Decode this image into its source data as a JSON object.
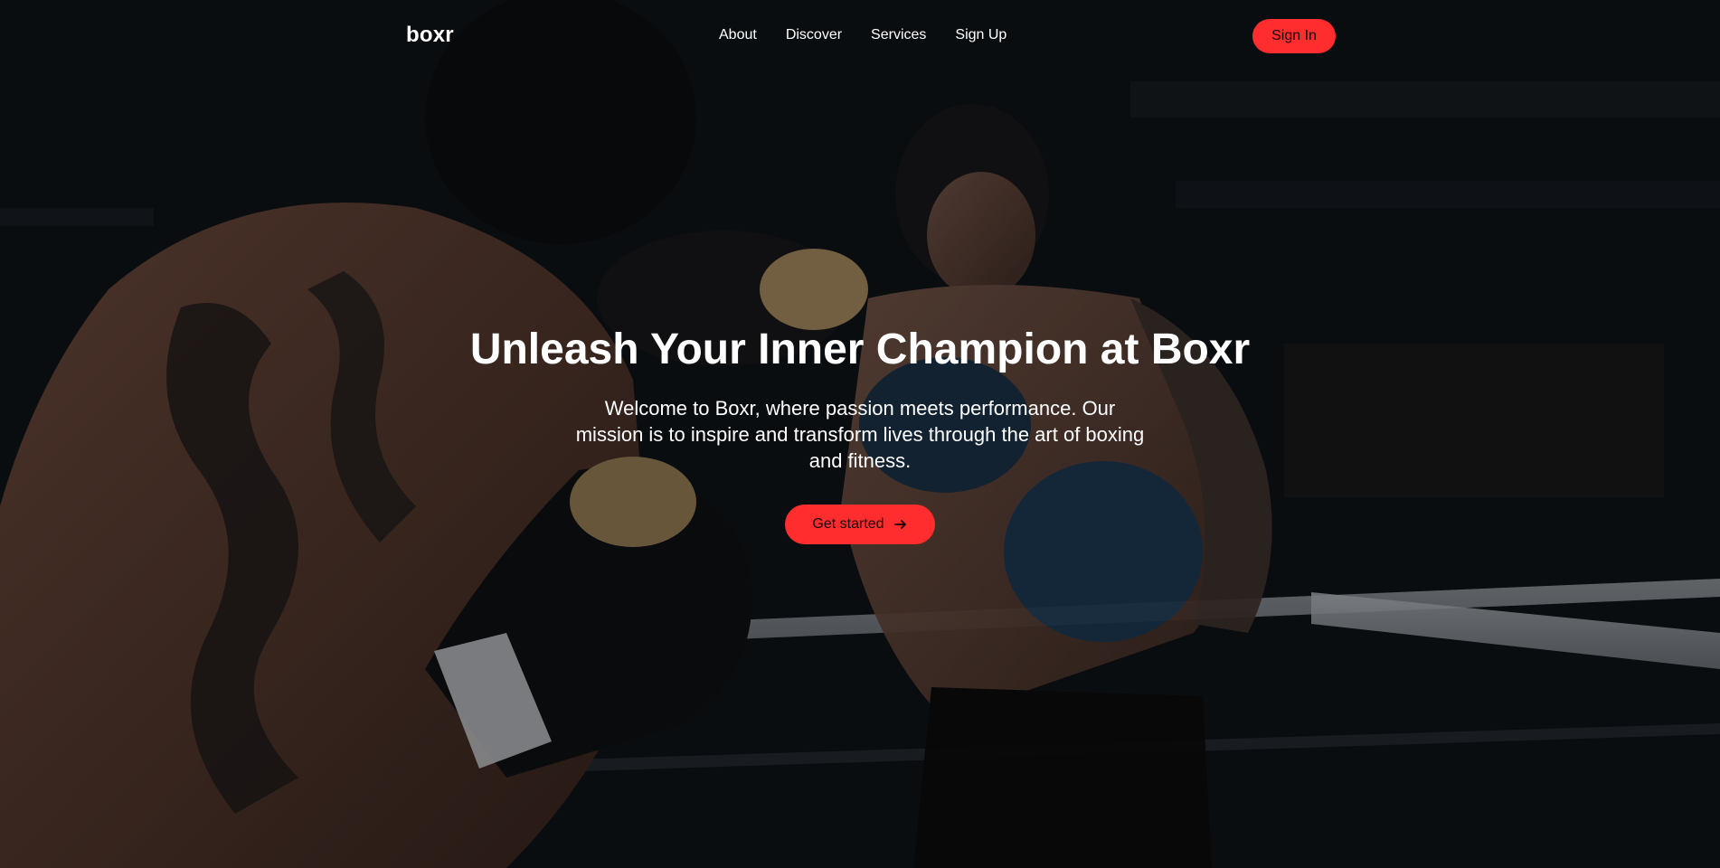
{
  "brand": {
    "logo_text": "boxr"
  },
  "nav": {
    "links": [
      {
        "label": "About"
      },
      {
        "label": "Discover"
      },
      {
        "label": "Services"
      },
      {
        "label": "Sign Up"
      }
    ],
    "signin_label": "Sign In"
  },
  "hero": {
    "headline": "Unleash Your Inner Champion at Boxr",
    "subtext": "Welcome to Boxr, where passion meets performance. Our mission is to inspire and transform lives through the art of boxing and fitness.",
    "cta_label": "Get started",
    "cta_icon": "arrow-right-icon",
    "background_image": "boxers-sparring-in-ring-photo"
  },
  "colors": {
    "accent": "#ff2d2d",
    "text": "#ffffff",
    "background": "#0c0f13"
  }
}
